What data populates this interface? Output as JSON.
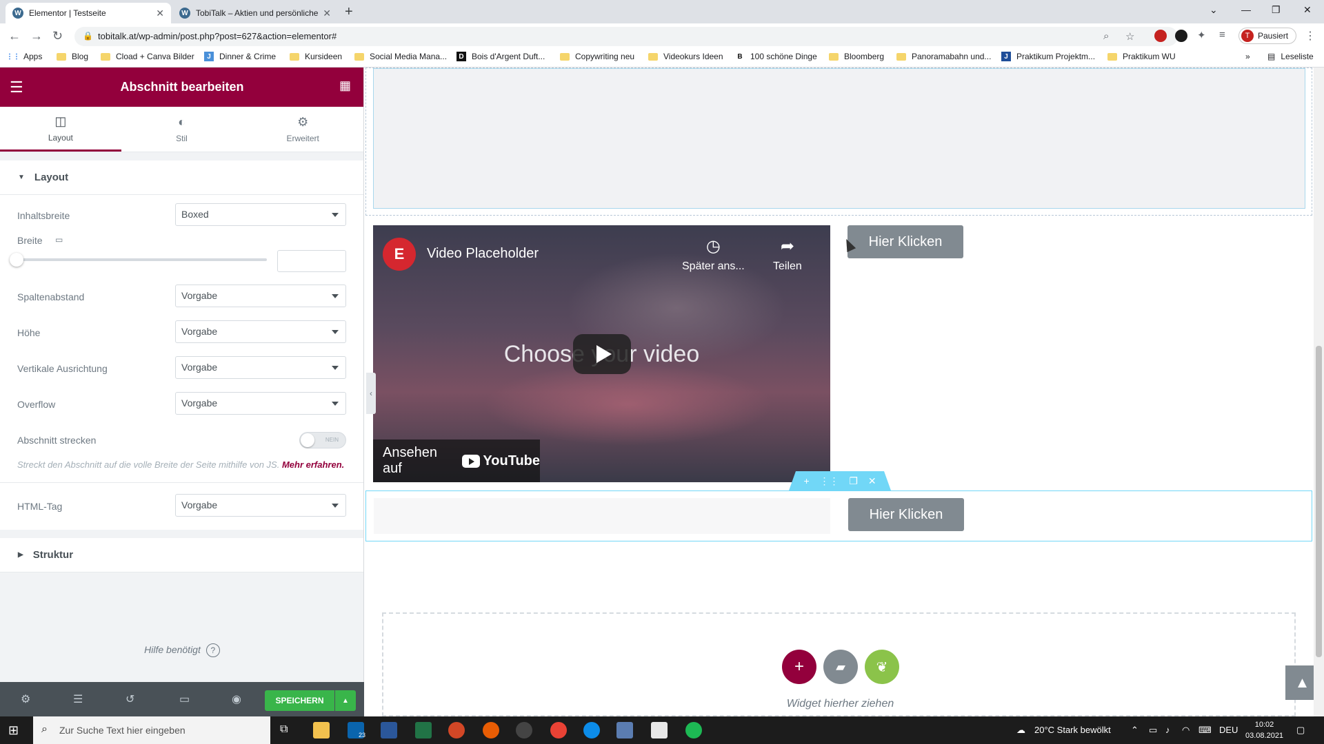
{
  "browser": {
    "tabs": [
      {
        "title": "Elementor | Testseite",
        "active": true
      },
      {
        "title": "TobiTalk – Aktien und persönliche",
        "active": false
      }
    ],
    "url": "tobitalk.at/wp-admin/post.php?post=627&action=elementor#",
    "profile_label": "Pausiert",
    "profile_initial": "T",
    "bookmarks": [
      "Apps",
      "Blog",
      "Cload + Canva Bilder",
      "Dinner & Crime",
      "Kursideen",
      "Social Media Mana...",
      "Bois d'Argent Duft...",
      "Copywriting neu",
      "Videokurs Ideen",
      "100 schöne Dinge",
      "Bloomberg",
      "Panoramabahn und...",
      "Praktikum Projektm...",
      "Praktikum WU"
    ],
    "reading_list": "Leseliste"
  },
  "panel": {
    "header_title": "Abschnitt bearbeiten",
    "tabs": [
      {
        "label": "Layout",
        "icon": "layout-icon"
      },
      {
        "label": "Stil",
        "icon": "contrast-icon"
      },
      {
        "label": "Erweitert",
        "icon": "gear-icon"
      }
    ],
    "layout_section": "Layout",
    "controls": {
      "content_width_label": "Inhaltsbreite",
      "content_width_value": "Boxed",
      "width_label": "Breite",
      "column_gap_label": "Spaltenabstand",
      "column_gap_value": "Vorgabe",
      "height_label": "Höhe",
      "height_value": "Vorgabe",
      "vertical_align_label": "Vertikale Ausrichtung",
      "vertical_align_value": "Vorgabe",
      "overflow_label": "Overflow",
      "overflow_value": "Vorgabe",
      "stretch_label": "Abschnitt strecken",
      "stretch_toggle_text": "NEIN",
      "stretch_help": "Streckt den Abschnitt auf die volle Breite der Seite mithilfe von JS.",
      "stretch_help_link": "Mehr erfahren.",
      "html_tag_label": "HTML-Tag",
      "html_tag_value": "Vorgabe"
    },
    "structure_section": "Struktur",
    "need_help": "Hilfe benötigt",
    "save_label": "SPEICHERN"
  },
  "canvas": {
    "video": {
      "title": "Video Placeholder",
      "watch_later": "Später ans...",
      "share": "Teilen",
      "center_text": "Choose your video",
      "watch_on": "Ansehen auf",
      "youtube": "YouTube"
    },
    "button_label": "Hier Klicken",
    "drop_text": "Widget hierher ziehen"
  },
  "taskbar": {
    "search_placeholder": "Zur Suche Text hier eingeben",
    "weather": "20°C  Stark bewölkt",
    "language": "DEU",
    "time": "10:02",
    "date": "03.08.2021",
    "mail_badge": "23"
  },
  "colors": {
    "elementor_primary": "#93003c",
    "save_green": "#39b54a",
    "section_cyan": "#71d7f7",
    "button_gray": "#818a91"
  }
}
